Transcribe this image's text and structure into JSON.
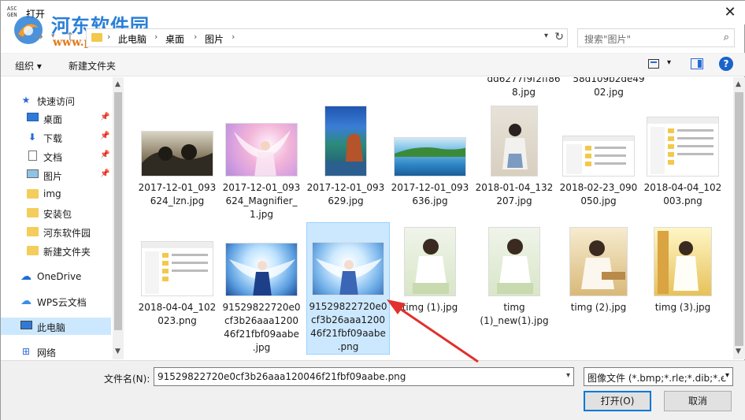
{
  "window": {
    "title": "打开",
    "app_icon_text": "ASC\nGEN",
    "watermark_title": "河东软件园",
    "watermark_url": "www.pc0359.cn"
  },
  "address": {
    "crumbs": [
      "此电脑",
      "桌面",
      "图片"
    ],
    "search_placeholder": "搜索\"图片\""
  },
  "toolbar": {
    "organize_label": "组织 ▾",
    "new_folder_label": "新建文件夹"
  },
  "sidebar": {
    "items": [
      {
        "label": "快速访问",
        "icon": "star-icon",
        "pinned": false
      },
      {
        "label": "桌面",
        "icon": "desktop-icon",
        "pinned": true
      },
      {
        "label": "下载",
        "icon": "download-icon",
        "pinned": true
      },
      {
        "label": "文档",
        "icon": "document-icon",
        "pinned": true
      },
      {
        "label": "图片",
        "icon": "pictures-icon",
        "pinned": true
      },
      {
        "label": "img",
        "icon": "folder-icon",
        "pinned": false
      },
      {
        "label": "安装包",
        "icon": "folder-icon",
        "pinned": false
      },
      {
        "label": "河东软件园",
        "icon": "folder-icon",
        "pinned": false
      },
      {
        "label": "新建文件夹",
        "icon": "folder-icon",
        "pinned": false
      },
      {
        "label": "OneDrive",
        "icon": "cloud-icon",
        "pinned": false
      },
      {
        "label": "WPS云文档",
        "icon": "cloud-icon",
        "pinned": false
      },
      {
        "label": "此电脑",
        "icon": "computer-icon",
        "pinned": false,
        "selected": true
      },
      {
        "label": "网络",
        "icon": "network-icon",
        "pinned": false
      }
    ]
  },
  "files": {
    "partial_row": [
      {
        "label": "dd6277f9f2ff86\n8.jpg"
      },
      {
        "label": "58d109b2de49\n02.jpg"
      }
    ],
    "row1": [
      {
        "label": "2017-12-01_093\n624_lzn.jpg"
      },
      {
        "label": "2017-12-01_093\n624_Magnifier_\n1.jpg"
      },
      {
        "label": "2017-12-01_093\n629.jpg"
      },
      {
        "label": "2017-12-01_093\n636.jpg"
      },
      {
        "label": "2018-01-04_132\n207.jpg"
      },
      {
        "label": "2018-02-23_090\n050.jpg"
      },
      {
        "label": "2018-04-04_102\n003.png"
      }
    ],
    "row2": [
      {
        "label": "2018-04-04_102\n023.png"
      },
      {
        "label": "91529822720e0\ncf3b26aaa1200\n46f21fbf09aabe\n.jpg"
      },
      {
        "label": "91529822720e0\ncf3b26aaa1200\n46f21fbf09aabe\n.png",
        "selected": true
      },
      {
        "label": "timg (1).jpg"
      },
      {
        "label": "timg\n(1)_new(1).jpg"
      },
      {
        "label": "timg (2).jpg"
      },
      {
        "label": "timg (3).jpg"
      }
    ]
  },
  "bottom": {
    "filename_label": "文件名(N):",
    "filename_value": "91529822720e0cf3b26aaa120046f21fbf09aabe.png",
    "filetype_value": "图像文件 (*.bmp;*.rle;*.dib;*.e",
    "open_label": "打开(O)",
    "cancel_label": "取消"
  },
  "colors": {
    "selection": "#cce8ff",
    "accent": "#0078d7",
    "annotation_arrow": "#e0312f"
  }
}
